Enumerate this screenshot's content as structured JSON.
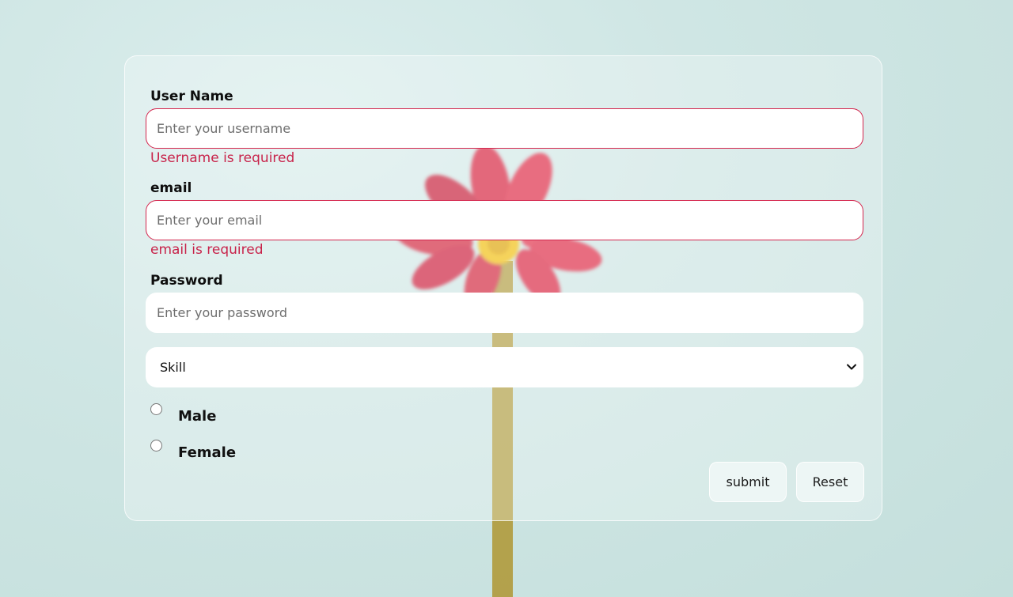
{
  "form": {
    "username": {
      "label": "User Name",
      "placeholder": "Enter your username",
      "value": "",
      "error": "Username is required"
    },
    "email": {
      "label": "email",
      "placeholder": "Enter your email",
      "value": "",
      "error": "email is required"
    },
    "password": {
      "label": "Password",
      "placeholder": "Enter your password",
      "value": ""
    },
    "skill": {
      "selected": "Skill"
    },
    "gender": {
      "options": [
        "Male",
        "Female"
      ],
      "selected": null
    },
    "buttons": {
      "submit": "submit",
      "reset": "Reset"
    }
  },
  "colors": {
    "error": "#c8234a",
    "invalid_border": "#d4254d",
    "background": "#cfe6e4",
    "flower_petal": "#e0354f",
    "flower_center": "#f2c21b",
    "stem": "#b09a3c"
  },
  "icons": {
    "select_arrow": "chevron-down-icon"
  }
}
